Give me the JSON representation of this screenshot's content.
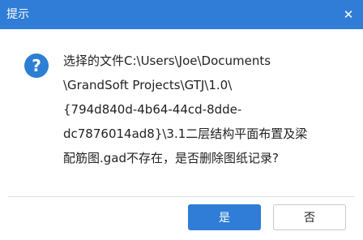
{
  "window": {
    "title": "提示",
    "close_glyph": "✕"
  },
  "dialog": {
    "icon": "question-icon",
    "icon_glyph": "?",
    "message_lines": [
      "选择的文件C:\\Users\\Joe\\Documents",
      "\\GrandSoft Projects\\GTJ\\1.0\\",
      "{794d840d-4b64-44cd-8dde-",
      "dc7876014ad8}\\3.1二层结构平面布置及梁",
      "配筋图.gad不存在，是否删除图纸记录?"
    ]
  },
  "buttons": {
    "yes": "是",
    "no": "否"
  },
  "colors": {
    "accent": "#2f7dd6",
    "icon": "#2c7fd3"
  }
}
